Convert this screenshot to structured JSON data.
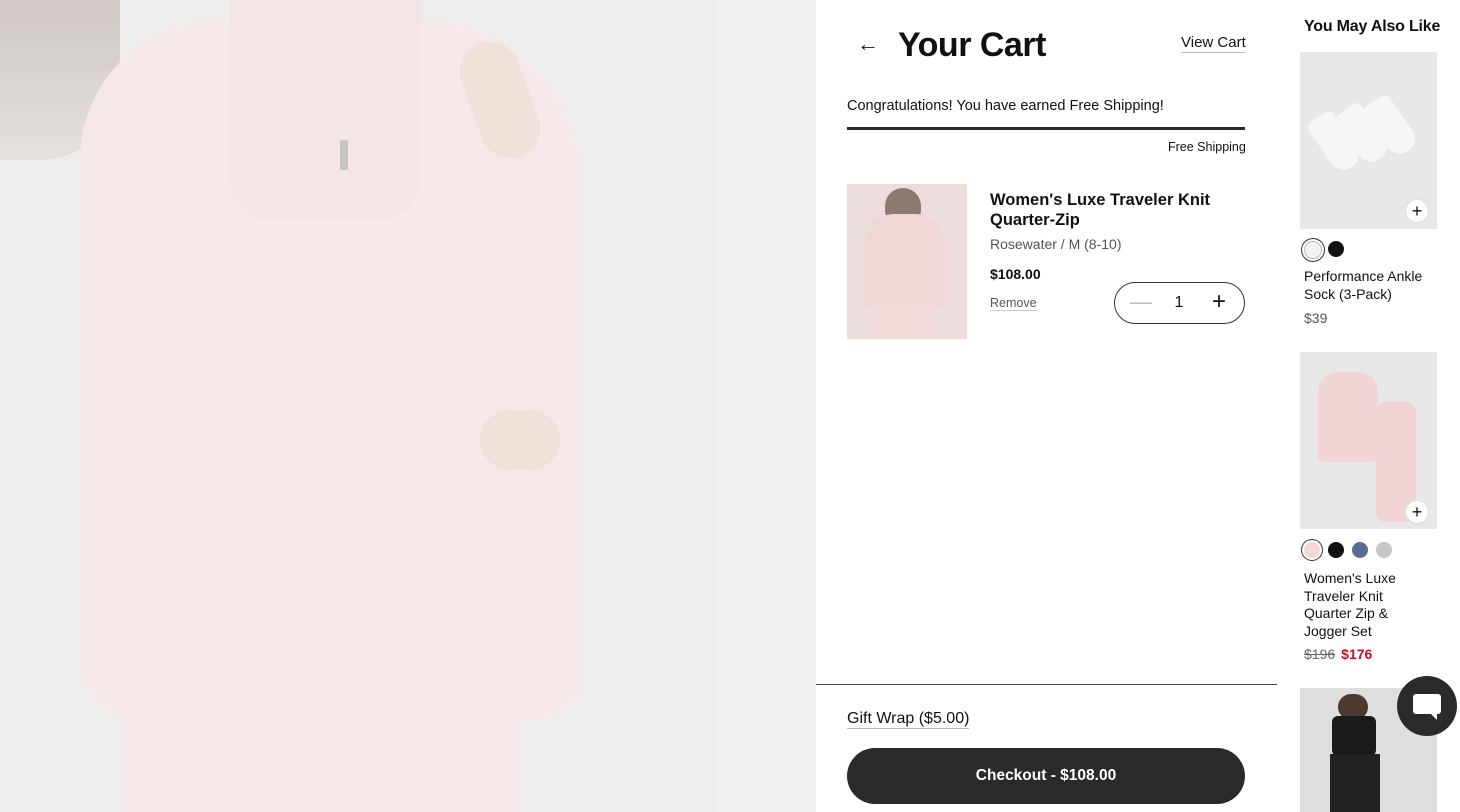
{
  "cart": {
    "title": "Your Cart",
    "view_cart_label": "View Cart",
    "shipping_message": "Congratulations! You have earned Free Shipping!",
    "shipping_progress_label": "Free Shipping",
    "shipping_progress": 1.0,
    "items": [
      {
        "name": "Women's Luxe Traveler Knit Quarter-Zip",
        "variant": "Rosewater / M (8-10)",
        "price": "$108.00",
        "remove_label": "Remove",
        "quantity": "1"
      }
    ],
    "gift_wrap_label": "Gift Wrap ($5.00)",
    "checkout_label": "Checkout - $108.00"
  },
  "recommendations": {
    "title": "You May Also Like",
    "items": [
      {
        "name": "Performance Ankle Sock (3-Pack)",
        "price": "$39",
        "swatches": [
          "#f2f2f2",
          "#111111"
        ]
      },
      {
        "name": "Women's Luxe Traveler Knit Quarter Zip & Jogger Set",
        "original_price": "$196",
        "sale_price": "$176",
        "swatches": [
          "#f3d6d6",
          "#111111",
          "#5a6b95",
          "#c6c6c6"
        ]
      }
    ]
  },
  "colors": {
    "checkout_bg": "#2a2a2a",
    "sale_price": "#c0102a"
  },
  "icons": {
    "back": "arrow-left-icon",
    "add": "plus-icon",
    "chat": "chat-icon"
  }
}
